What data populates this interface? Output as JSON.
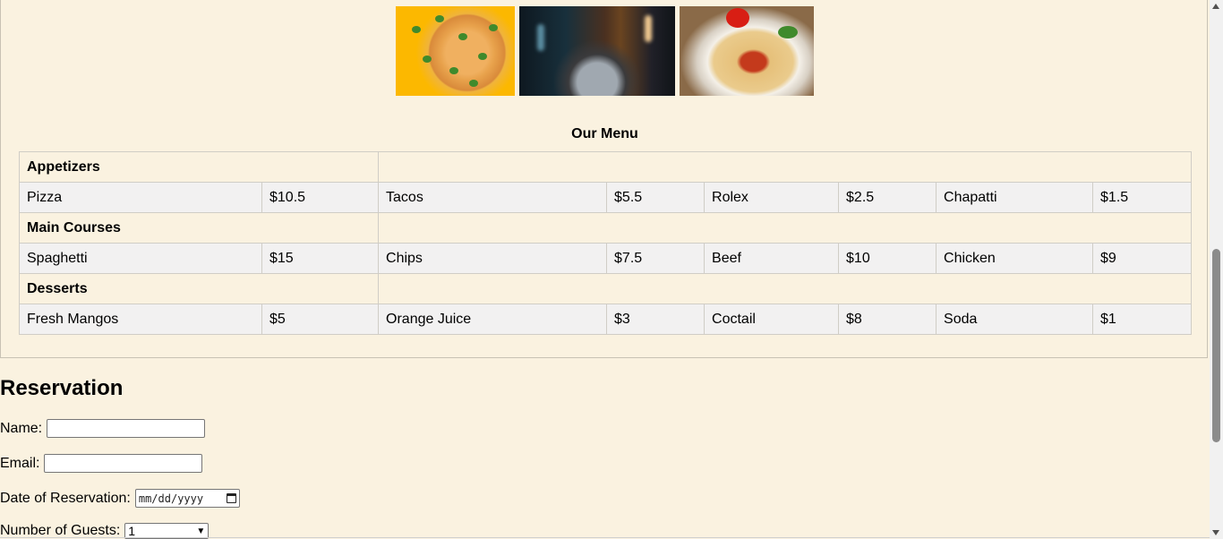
{
  "gallery": {
    "images": [
      {
        "subject": "pizza"
      },
      {
        "subject": "restaurant-dish"
      },
      {
        "subject": "spaghetti"
      }
    ]
  },
  "menu": {
    "title": "Our Menu",
    "categories": [
      {
        "name": "Appetizers",
        "items": [
          {
            "name": "Pizza",
            "price": "$10.5"
          },
          {
            "name": "Tacos",
            "price": "$5.5"
          },
          {
            "name": "Rolex",
            "price": "$2.5"
          },
          {
            "name": "Chapatti",
            "price": "$1.5"
          }
        ]
      },
      {
        "name": "Main Courses",
        "items": [
          {
            "name": "Spaghetti",
            "price": "$15"
          },
          {
            "name": "Chips",
            "price": "$7.5"
          },
          {
            "name": "Beef",
            "price": "$10"
          },
          {
            "name": "Chicken",
            "price": "$9"
          }
        ]
      },
      {
        "name": "Desserts",
        "items": [
          {
            "name": "Fresh Mangos",
            "price": "$5"
          },
          {
            "name": "Orange Juice",
            "price": "$3"
          },
          {
            "name": "Coctail",
            "price": "$8"
          },
          {
            "name": "Soda",
            "price": "$1"
          }
        ]
      }
    ]
  },
  "reservation": {
    "heading": "Reservation",
    "name_label": "Name:",
    "email_label": "Email:",
    "date_label": "Date of Reservation:",
    "date_placeholder": "mm/dd/yyyy",
    "guests_label": "Number of Guests:",
    "guests_value": "1"
  },
  "colors": {
    "background": "#faf2e0",
    "item_row": "#f2f1f1",
    "border": "#d0cdc6"
  },
  "icons": {
    "date": "calendar-icon",
    "select": "chevron-down-icon",
    "scroll_up": "scroll-up-arrow-icon",
    "scroll_down": "scroll-down-arrow-icon"
  }
}
